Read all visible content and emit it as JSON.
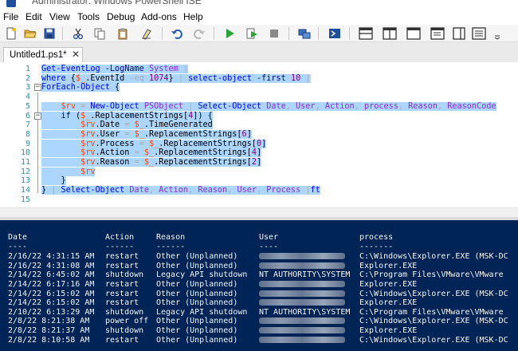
{
  "window": {
    "title": "Administrator: Windows PowerShell ISE"
  },
  "menu": [
    "File",
    "Edit",
    "View",
    "Tools",
    "Debug",
    "Add-ons",
    "Help"
  ],
  "toolbar_icons": [
    "new-file-icon",
    "open-folder-icon",
    "save-icon",
    "cut-icon",
    "copy-icon",
    "paste-icon",
    "clear-icon",
    "undo-icon",
    "redo-icon",
    "run-icon",
    "run-selection-icon",
    "stop-icon",
    "remote-powershell-icon",
    "powershell-console-icon",
    "layout-top-icon",
    "layout-right-icon",
    "layout-max-icon",
    "layout-script-icon",
    "toolbar-overflow-icon"
  ],
  "tab": {
    "label": "Untitled1.ps1*",
    "close": "✕"
  },
  "editor": {
    "lines": [
      {
        "n": "1",
        "tokens": [
          {
            "t": "Get-EventLog",
            "c": "cmd"
          },
          {
            "t": " "
          },
          {
            "t": "-LogName",
            "c": "prm"
          },
          {
            "t": " "
          },
          {
            "t": "System",
            "c": "arg"
          },
          {
            "t": " |",
            "c": "op"
          }
        ]
      },
      {
        "n": "2",
        "tokens": [
          {
            "t": "where",
            "c": "cmd"
          },
          {
            "t": " {"
          },
          {
            "t": "$_",
            "c": "var"
          },
          {
            "t": "."
          },
          {
            "t": "EventId",
            "c": "mem"
          },
          {
            "t": " -eq",
            "c": "op"
          },
          {
            "t": " "
          },
          {
            "t": "1074",
            "c": "num"
          },
          {
            "t": "}"
          },
          {
            "t": " |",
            "c": "op"
          },
          {
            "t": " "
          },
          {
            "t": "select-object",
            "c": "cmd"
          },
          {
            "t": " "
          },
          {
            "t": "-first",
            "c": "prm"
          },
          {
            "t": " "
          },
          {
            "t": "10",
            "c": "num"
          },
          {
            "t": " |",
            "c": "op"
          }
        ]
      },
      {
        "n": "3",
        "tokens": [
          {
            "t": "ForEach-Object",
            "c": "cmd"
          },
          {
            "t": " {"
          }
        ]
      },
      {
        "n": "4",
        "tokens": []
      },
      {
        "n": "5",
        "tokens": [
          {
            "t": "    "
          },
          {
            "t": "$rv",
            "c": "var"
          },
          {
            "t": " = ",
            "c": "op"
          },
          {
            "t": "New-Object",
            "c": "cmd"
          },
          {
            "t": " "
          },
          {
            "t": "PSObject",
            "c": "arg"
          },
          {
            "t": " | ",
            "c": "op"
          },
          {
            "t": "Select-Object",
            "c": "cmd"
          },
          {
            "t": " "
          },
          {
            "t": "Date",
            "c": "arg"
          },
          {
            "t": ", ",
            "c": "op"
          },
          {
            "t": "User",
            "c": "arg"
          },
          {
            "t": ", ",
            "c": "op"
          },
          {
            "t": "Action",
            "c": "arg"
          },
          {
            "t": ", ",
            "c": "op"
          },
          {
            "t": "process",
            "c": "arg"
          },
          {
            "t": ", ",
            "c": "op"
          },
          {
            "t": "Reason",
            "c": "arg"
          },
          {
            "t": ", ",
            "c": "op"
          },
          {
            "t": "ReasonCode",
            "c": "arg"
          }
        ]
      },
      {
        "n": "6",
        "tokens": [
          {
            "t": "    "
          },
          {
            "t": "if",
            "c": "kw"
          },
          {
            "t": " ("
          },
          {
            "t": "$_",
            "c": "var"
          },
          {
            "t": "."
          },
          {
            "t": "ReplacementStrings",
            "c": "mem"
          },
          {
            "t": "["
          },
          {
            "t": "4",
            "c": "num"
          },
          {
            "t": "]) {"
          }
        ]
      },
      {
        "n": "7",
        "tokens": [
          {
            "t": "        "
          },
          {
            "t": "$rv",
            "c": "var"
          },
          {
            "t": "."
          },
          {
            "t": "Date",
            "c": "mem"
          },
          {
            "t": " = ",
            "c": "op"
          },
          {
            "t": "$_",
            "c": "var"
          },
          {
            "t": "."
          },
          {
            "t": "TimeGenerated",
            "c": "mem"
          }
        ]
      },
      {
        "n": "8",
        "tokens": [
          {
            "t": "        "
          },
          {
            "t": "$rv",
            "c": "var"
          },
          {
            "t": "."
          },
          {
            "t": "User",
            "c": "mem"
          },
          {
            "t": " = ",
            "c": "op"
          },
          {
            "t": "$_",
            "c": "var"
          },
          {
            "t": "."
          },
          {
            "t": "ReplacementStrings",
            "c": "mem"
          },
          {
            "t": "["
          },
          {
            "t": "6",
            "c": "num"
          },
          {
            "t": "]"
          }
        ]
      },
      {
        "n": "9",
        "tokens": [
          {
            "t": "        "
          },
          {
            "t": "$rv",
            "c": "var"
          },
          {
            "t": "."
          },
          {
            "t": "Process",
            "c": "mem"
          },
          {
            "t": " = ",
            "c": "op"
          },
          {
            "t": "$_",
            "c": "var"
          },
          {
            "t": "."
          },
          {
            "t": "ReplacementStrings",
            "c": "mem"
          },
          {
            "t": "["
          },
          {
            "t": "0",
            "c": "num"
          },
          {
            "t": "]"
          }
        ]
      },
      {
        "n": "10",
        "tokens": [
          {
            "t": "        "
          },
          {
            "t": "$rv",
            "c": "var"
          },
          {
            "t": "."
          },
          {
            "t": "Action",
            "c": "mem"
          },
          {
            "t": " = ",
            "c": "op"
          },
          {
            "t": "$_",
            "c": "var"
          },
          {
            "t": "."
          },
          {
            "t": "ReplacementStrings",
            "c": "mem"
          },
          {
            "t": "["
          },
          {
            "t": "4",
            "c": "num"
          },
          {
            "t": "]"
          }
        ]
      },
      {
        "n": "11",
        "tokens": [
          {
            "t": "        "
          },
          {
            "t": "$rv",
            "c": "var"
          },
          {
            "t": "."
          },
          {
            "t": "Reason",
            "c": "mem"
          },
          {
            "t": " = ",
            "c": "op"
          },
          {
            "t": "$_",
            "c": "var"
          },
          {
            "t": "."
          },
          {
            "t": "ReplacementStrings",
            "c": "mem"
          },
          {
            "t": "["
          },
          {
            "t": "2",
            "c": "num"
          },
          {
            "t": "]"
          }
        ]
      },
      {
        "n": "12",
        "tokens": [
          {
            "t": "        "
          },
          {
            "t": "$rv",
            "c": "var"
          }
        ]
      },
      {
        "n": "13",
        "tokens": [
          {
            "t": "    }"
          }
        ]
      },
      {
        "n": "14",
        "tokens": [
          {
            "t": "}"
          },
          {
            "t": " | ",
            "c": "op"
          },
          {
            "t": "Select-Object",
            "c": "cmd"
          },
          {
            "t": " "
          },
          {
            "t": "Date",
            "c": "arg"
          },
          {
            "t": ", ",
            "c": "op"
          },
          {
            "t": "Action",
            "c": "arg"
          },
          {
            "t": ", ",
            "c": "op"
          },
          {
            "t": "Reason",
            "c": "arg"
          },
          {
            "t": ", ",
            "c": "op"
          },
          {
            "t": "User",
            "c": "arg"
          },
          {
            "t": ", ",
            "c": "op"
          },
          {
            "t": "Process",
            "c": "arg"
          },
          {
            "t": " |",
            "c": "op"
          },
          {
            "t": "ft",
            "c": "cmd"
          }
        ]
      },
      {
        "n": "15",
        "tokens": []
      }
    ]
  },
  "console": {
    "headers": {
      "date": "Date",
      "action": "Action",
      "reason": "Reason",
      "user": "User",
      "process": "process"
    },
    "underline": {
      "date": "----",
      "action": "------",
      "reason": "------",
      "user": "----",
      "process": "-------"
    },
    "rows": [
      {
        "date": "2/16/22 4:31:15 AM",
        "action": "restart",
        "reason": "Other (Unplanned)",
        "user": "",
        "process": "C:\\Windows\\Explorer.EXE (MSK-DC"
      },
      {
        "date": "2/16/22 4:31:08 AM",
        "action": "restart",
        "reason": "Other (Unplanned)",
        "user": "",
        "process": "Explorer.EXE"
      },
      {
        "date": "2/14/22 6:45:02 AM",
        "action": "shutdown",
        "reason": "Legacy API shutdown",
        "user": "NT AUTHORITY\\SYSTEM",
        "process": "C:\\Program Files\\VMware\\VMware"
      },
      {
        "date": "2/14/22 6:17:16 AM",
        "action": "restart",
        "reason": "Other (Unplanned)",
        "user": "",
        "process": "Explorer.EXE"
      },
      {
        "date": "2/14/22 6:15:02 AM",
        "action": "restart",
        "reason": "Other (Unplanned)",
        "user": "",
        "process": "C:\\Windows\\Explorer.EXE (MSK-DC"
      },
      {
        "date": "2/14/22 6:15:02 AM",
        "action": "restart",
        "reason": "Other (Unplanned)",
        "user": "",
        "process": "Explorer.EXE"
      },
      {
        "date": "2/10/22 6:13:29 AM",
        "action": "shutdown",
        "reason": "Legacy API shutdown",
        "user": "NT AUTHORITY\\SYSTEM",
        "process": "C:\\Program Files\\VMware\\VMware"
      },
      {
        "date": "2/8/22 8:21:38 AM",
        "action": "power off",
        "reason": "Other (Unplanned)",
        "user": "",
        "process": "C:\\Windows\\Explorer.EXE (MSK-DC"
      },
      {
        "date": "2/8/22 8:21:37 AM",
        "action": "shutdown",
        "reason": "Other (Unplanned)",
        "user": "",
        "process": "Explorer.EXE"
      },
      {
        "date": "2/8/22 8:10:58 AM",
        "action": "restart",
        "reason": "Other (Unplanned)",
        "user": "",
        "process": "C:\\Windows\\Explorer.EXE (MSK-DC"
      }
    ]
  },
  "colors": {
    "console_bg": "#012456",
    "selection": "#add6ff",
    "cmdlet": "#0000ff",
    "variable": "#ff4500"
  }
}
